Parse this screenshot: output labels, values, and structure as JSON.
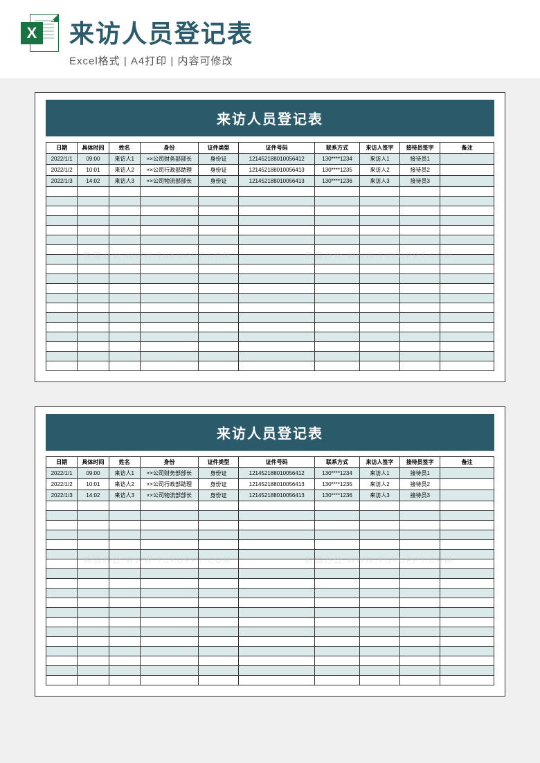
{
  "header": {
    "mainTitle": "来访人员登记表",
    "subTitle": "Excel格式 | A4打印 | 内容可修改",
    "iconLetter": "X"
  },
  "sheet": {
    "title": "来访人员登记表",
    "columns": [
      "日期",
      "具体时间",
      "姓名",
      "身份",
      "证件类型",
      "证件号码",
      "联系方式",
      "来访人签字",
      "接待员签字",
      "备注"
    ],
    "rows": [
      [
        "2022/1/1",
        "09:00",
        "来访人1",
        "××公司财务部部长",
        "身份证",
        "121452188010056412",
        "130****1234",
        "来访人1",
        "接待员1",
        ""
      ],
      [
        "2022/1/2",
        "10:01",
        "来访人2",
        "××公司行政部助理",
        "身份证",
        "121452188010056413",
        "130****1235",
        "来访人2",
        "接待员2",
        ""
      ],
      [
        "2022/1/3",
        "14:02",
        "来访人3",
        "××公司物流部部长",
        "身份证",
        "121452188010056413",
        "130****1236",
        "来访人3",
        "接待员3",
        ""
      ]
    ],
    "emptyRows": 19
  },
  "watermark": "熊猫办公 WWW.TUKUPPT.COM"
}
